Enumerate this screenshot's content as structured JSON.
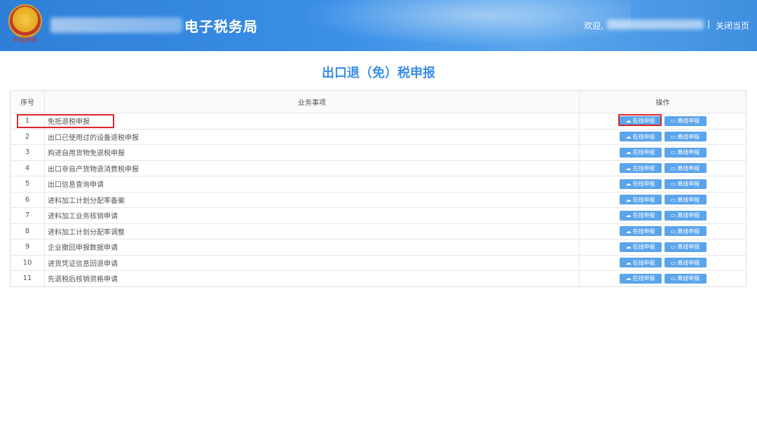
{
  "header": {
    "emblem_text": "中国税务",
    "system_title": "电子税务局",
    "welcome": "欢迎,",
    "divider": "|",
    "close_page": "关闭当页"
  },
  "page": {
    "title": "出口退（免）税申报"
  },
  "table": {
    "headers": {
      "no": "序号",
      "item": "业务事项",
      "op": "操作"
    },
    "online_label": "在线申报",
    "offline_label": "离线申报",
    "rows": [
      {
        "no": "1",
        "item": "免抵退税申报"
      },
      {
        "no": "2",
        "item": "出口已使用过的设备退税申报"
      },
      {
        "no": "3",
        "item": "购进自用货物免退税申报"
      },
      {
        "no": "4",
        "item": "出口非自产货物退消费税申报"
      },
      {
        "no": "5",
        "item": "出口信息查询申请"
      },
      {
        "no": "6",
        "item": "进料加工计划分配率备案"
      },
      {
        "no": "7",
        "item": "进料加工业务核销申请"
      },
      {
        "no": "8",
        "item": "进料加工计划分配率调整"
      },
      {
        "no": "9",
        "item": "企业撤回申报数据申请"
      },
      {
        "no": "10",
        "item": "进货凭证信息回退申请"
      },
      {
        "no": "11",
        "item": "先退税后核销资格申请"
      }
    ]
  },
  "colors": {
    "header_blue": "#2f7fd8",
    "title_blue": "#3a8ee6",
    "button_blue": "#5aa4ec",
    "highlight_red": "#d9262c"
  },
  "icons": {
    "online": "cloud-upload-icon",
    "offline": "laptop-icon"
  }
}
